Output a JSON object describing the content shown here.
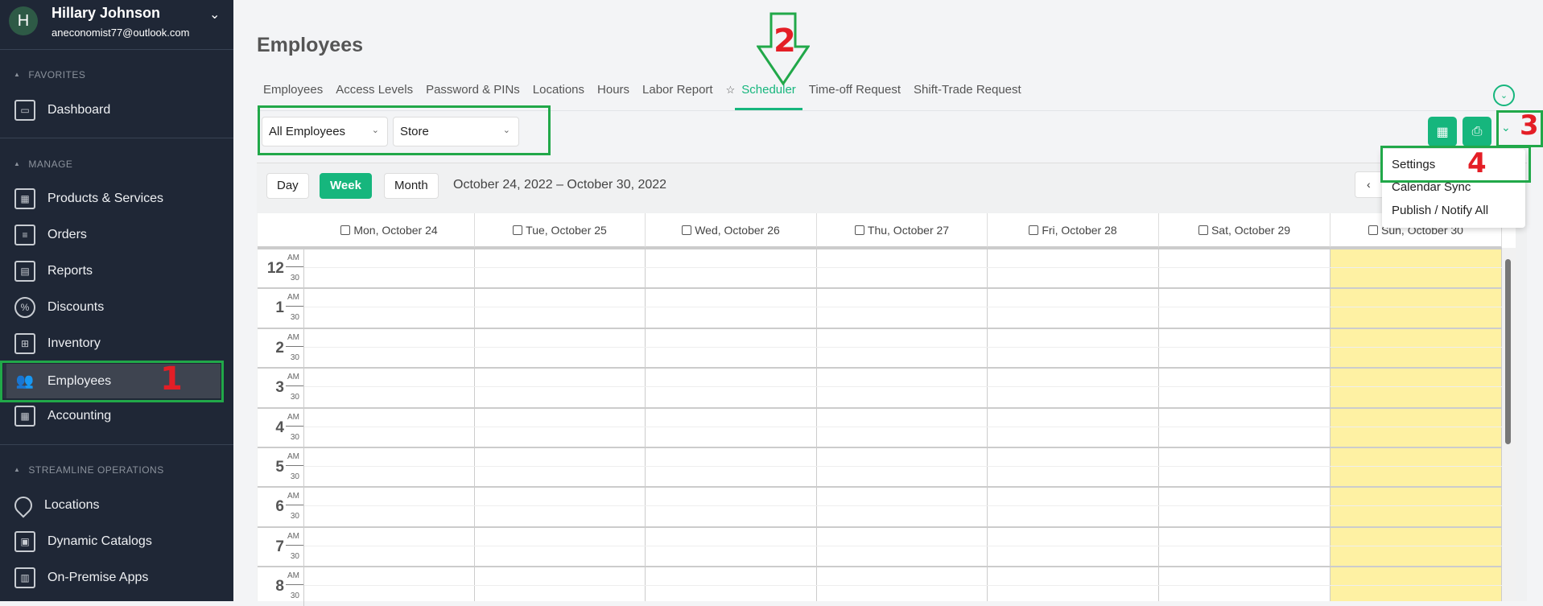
{
  "user": {
    "initial": "H",
    "name": "Hillary Johnson",
    "email": "aneconomist77@outlook.com"
  },
  "sidebar": {
    "sections": [
      {
        "label": "FAVORITES"
      },
      {
        "label": "MANAGE"
      },
      {
        "label": "STREAMLINE OPERATIONS"
      }
    ],
    "items": [
      {
        "label": "Dashboard",
        "icon": "monitor-icon"
      },
      {
        "label": "Products & Services",
        "icon": "boxes-icon"
      },
      {
        "label": "Orders",
        "icon": "order-doc-icon"
      },
      {
        "label": "Reports",
        "icon": "report-icon"
      },
      {
        "label": "Discounts",
        "icon": "percent-icon"
      },
      {
        "label": "Inventory",
        "icon": "store-icon"
      },
      {
        "label": "Employees",
        "icon": "people-icon",
        "active": true
      },
      {
        "label": "Accounting",
        "icon": "calculator-icon"
      },
      {
        "label": "Locations",
        "icon": "map-pin-icon"
      },
      {
        "label": "Dynamic Catalogs",
        "icon": "catalog-icon"
      },
      {
        "label": "On-Premise Apps",
        "icon": "pos-terminal-icon"
      }
    ]
  },
  "page": {
    "title": "Employees"
  },
  "tabs": [
    "Employees",
    "Access Levels",
    "Password & PINs",
    "Locations",
    "Hours",
    "Labor Report",
    "Scheduler",
    "Time-off Request",
    "Shift-Trade Request"
  ],
  "active_tab": "Scheduler",
  "filters": {
    "employees": "All Employees",
    "location": "Store"
  },
  "calendar": {
    "views": [
      "Day",
      "Week",
      "Month"
    ],
    "active_view": "Week",
    "range": "October 24, 2022 – October 30, 2022",
    "prev": "‹",
    "days": [
      "Mon, October 24",
      "Tue, October 25",
      "Wed, October 26",
      "Thu, October 27",
      "Fri, October 28",
      "Sat, October 29",
      "Sun, October 30"
    ],
    "today_index": 6,
    "hours": [
      "12",
      "1",
      "2",
      "3",
      "4",
      "5",
      "6",
      "7",
      "8"
    ],
    "am": "AM",
    "half": "30",
    "today_color": "#fef1a3"
  },
  "menu": {
    "items": [
      "Settings",
      "Calendar Sync",
      "Publish / Notify All"
    ]
  },
  "annotations": [
    "1",
    "2",
    "3",
    "4"
  ],
  "colors": {
    "accent": "#16b67d",
    "sidebar": "#1f2736",
    "annotation_box": "#21a849",
    "annotation_num": "#e41e26"
  }
}
